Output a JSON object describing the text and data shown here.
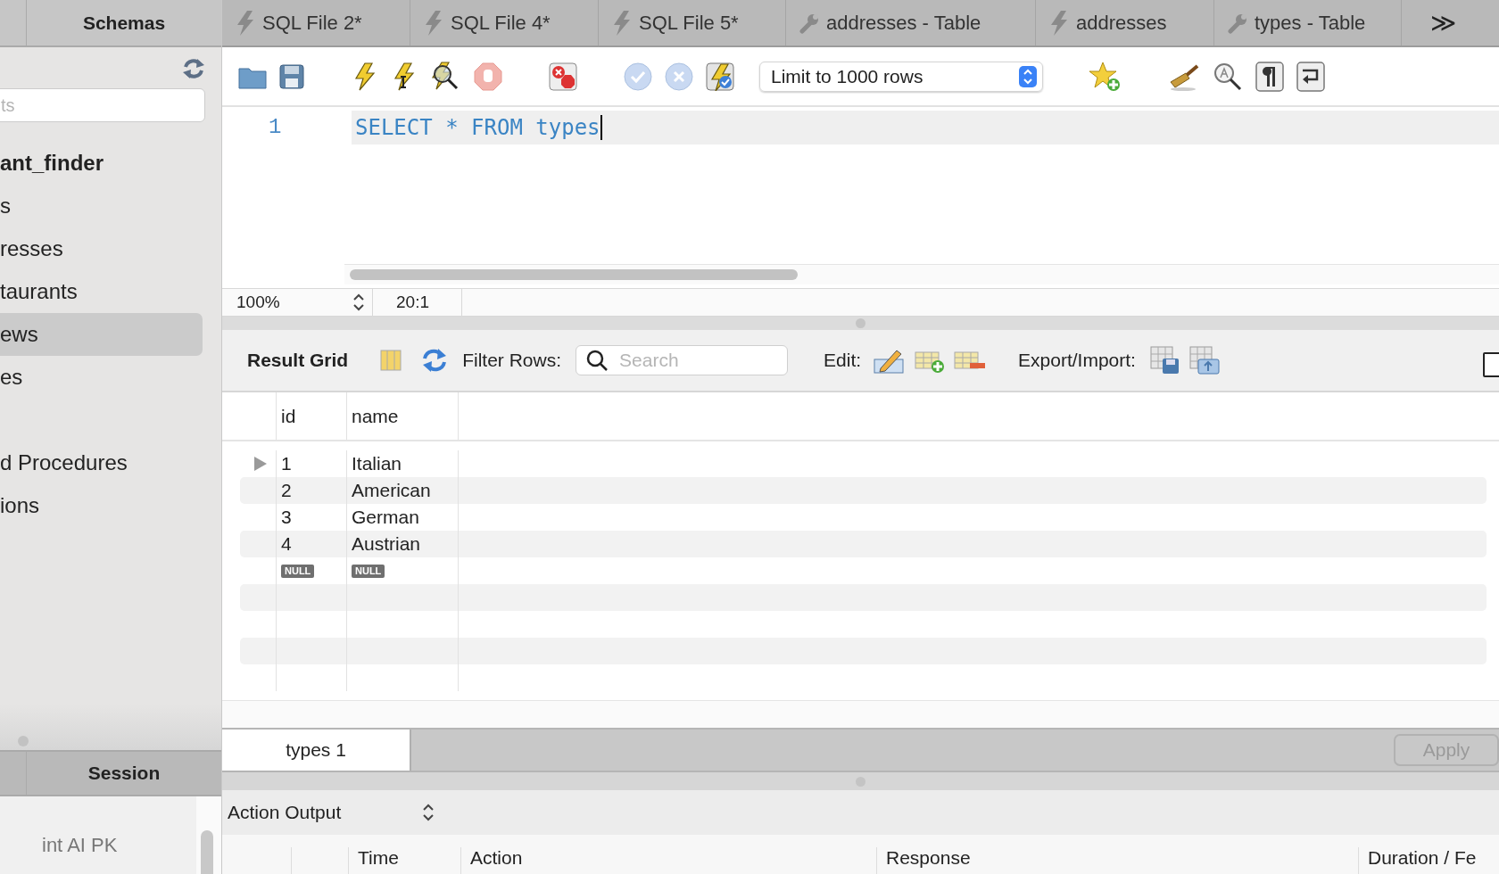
{
  "sidebar": {
    "tabs": [
      {
        "label": "Schemas"
      }
    ],
    "search": {
      "placeholder": "ts"
    },
    "tree": [
      {
        "label": "ant_finder",
        "selected": false,
        "children": [
          {
            "label": "s",
            "selected": false,
            "children": [
              {
                "label": "resses",
                "selected": false
              },
              {
                "label": "taurants",
                "selected": false
              },
              {
                "label": "ews",
                "selected": true
              },
              {
                "label": "es",
                "selected": false
              }
            ]
          },
          {
            "label": "d Procedures",
            "selected": false
          },
          {
            "label": "ions",
            "selected": false
          }
        ]
      }
    ],
    "bottom_tabs": [
      {
        "label": "Session"
      }
    ],
    "session_text": "int AI PK"
  },
  "editor_tabs": [
    {
      "label": "SQL File 2*",
      "kind": "query"
    },
    {
      "label": "SQL File 4*",
      "kind": "query"
    },
    {
      "label": "SQL File 5*",
      "kind": "query"
    },
    {
      "label": "addresses - Table",
      "kind": "table"
    },
    {
      "label": "addresses",
      "kind": "query"
    },
    {
      "label": "types - Table",
      "kind": "table"
    }
  ],
  "tabs_overflow": "≫",
  "toolbar": {
    "limit": "Limit to 1000 rows"
  },
  "editor": {
    "lines": [
      {
        "number": "1",
        "code": "SELECT * FROM types"
      }
    ]
  },
  "status_bar": {
    "zoom": "100%",
    "position": "20:1"
  },
  "results": {
    "title": "Result Grid",
    "filter_label": "Filter Rows:",
    "search": {
      "placeholder": "Search"
    },
    "edit_label": "Edit:",
    "export_label": "Export/Import:",
    "columns": [
      "id",
      "name"
    ],
    "rows": [
      {
        "kind": "data",
        "selected": true,
        "cells": [
          "1",
          "Italian"
        ]
      },
      {
        "kind": "data",
        "selected": false,
        "cells": [
          "2",
          "American"
        ]
      },
      {
        "kind": "data",
        "selected": false,
        "cells": [
          "3",
          "German"
        ]
      },
      {
        "kind": "data",
        "selected": false,
        "cells": [
          "4",
          "Austrian"
        ]
      },
      {
        "kind": "new",
        "selected": false,
        "cells": [
          "NULL",
          "NULL"
        ]
      }
    ],
    "tabs": [
      {
        "label": "types 1",
        "selected": true
      }
    ],
    "apply": {
      "label": "Apply",
      "disabled": true
    }
  },
  "output": {
    "selector": "Action Output",
    "columns": [
      "Time",
      "Action",
      "Response",
      "Duration / Fe"
    ]
  }
}
